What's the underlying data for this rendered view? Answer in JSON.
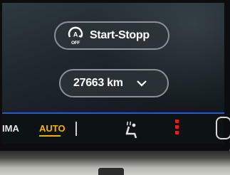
{
  "start_stop": {
    "label": "Start-Stopp",
    "icon": "auto-start-stop-off-icon",
    "icon_text": "OFF"
  },
  "odometer": {
    "value": "27663 km",
    "icon": "chevron-down-icon"
  },
  "bottom_bar": {
    "klima_label": "IMA",
    "auto_label": "AUTO",
    "auto_color": "#f0b400",
    "accent_color": "#1f5fc8",
    "seat_icon": "heated-seat-icon",
    "indicator_color": "#e0202a"
  }
}
